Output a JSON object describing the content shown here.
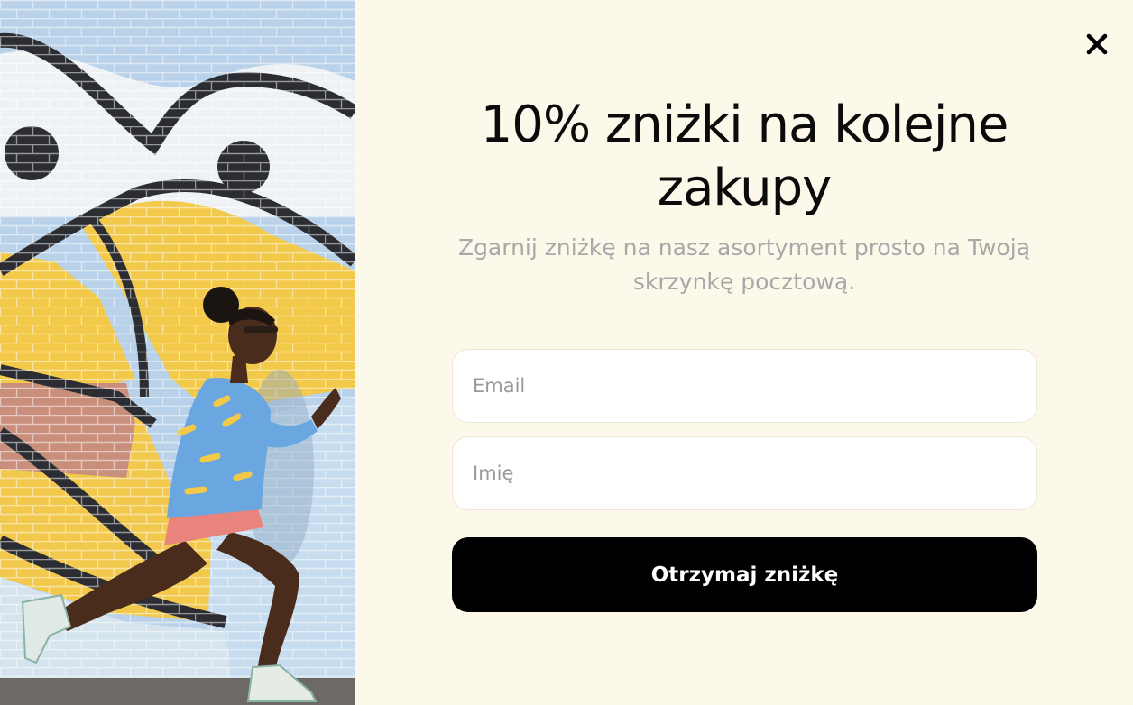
{
  "popup": {
    "headline": "10% zniżki na kolejne zakupy",
    "subtitle": "Zgarnij zniżkę na nasz asortyment prosto na Twoją skrzynkę pocztową.",
    "close_icon": "close-icon",
    "form": {
      "email_placeholder": "Email",
      "email_value": "",
      "name_placeholder": "Imię",
      "name_value": "",
      "submit_label": "Otrzymaj zniżkę"
    }
  },
  "colors": {
    "background": "#fdf9ea",
    "headline": "#0b0b0b",
    "subtitle": "#a8a8a8",
    "button": "#000000",
    "button_text": "#ffffff"
  }
}
